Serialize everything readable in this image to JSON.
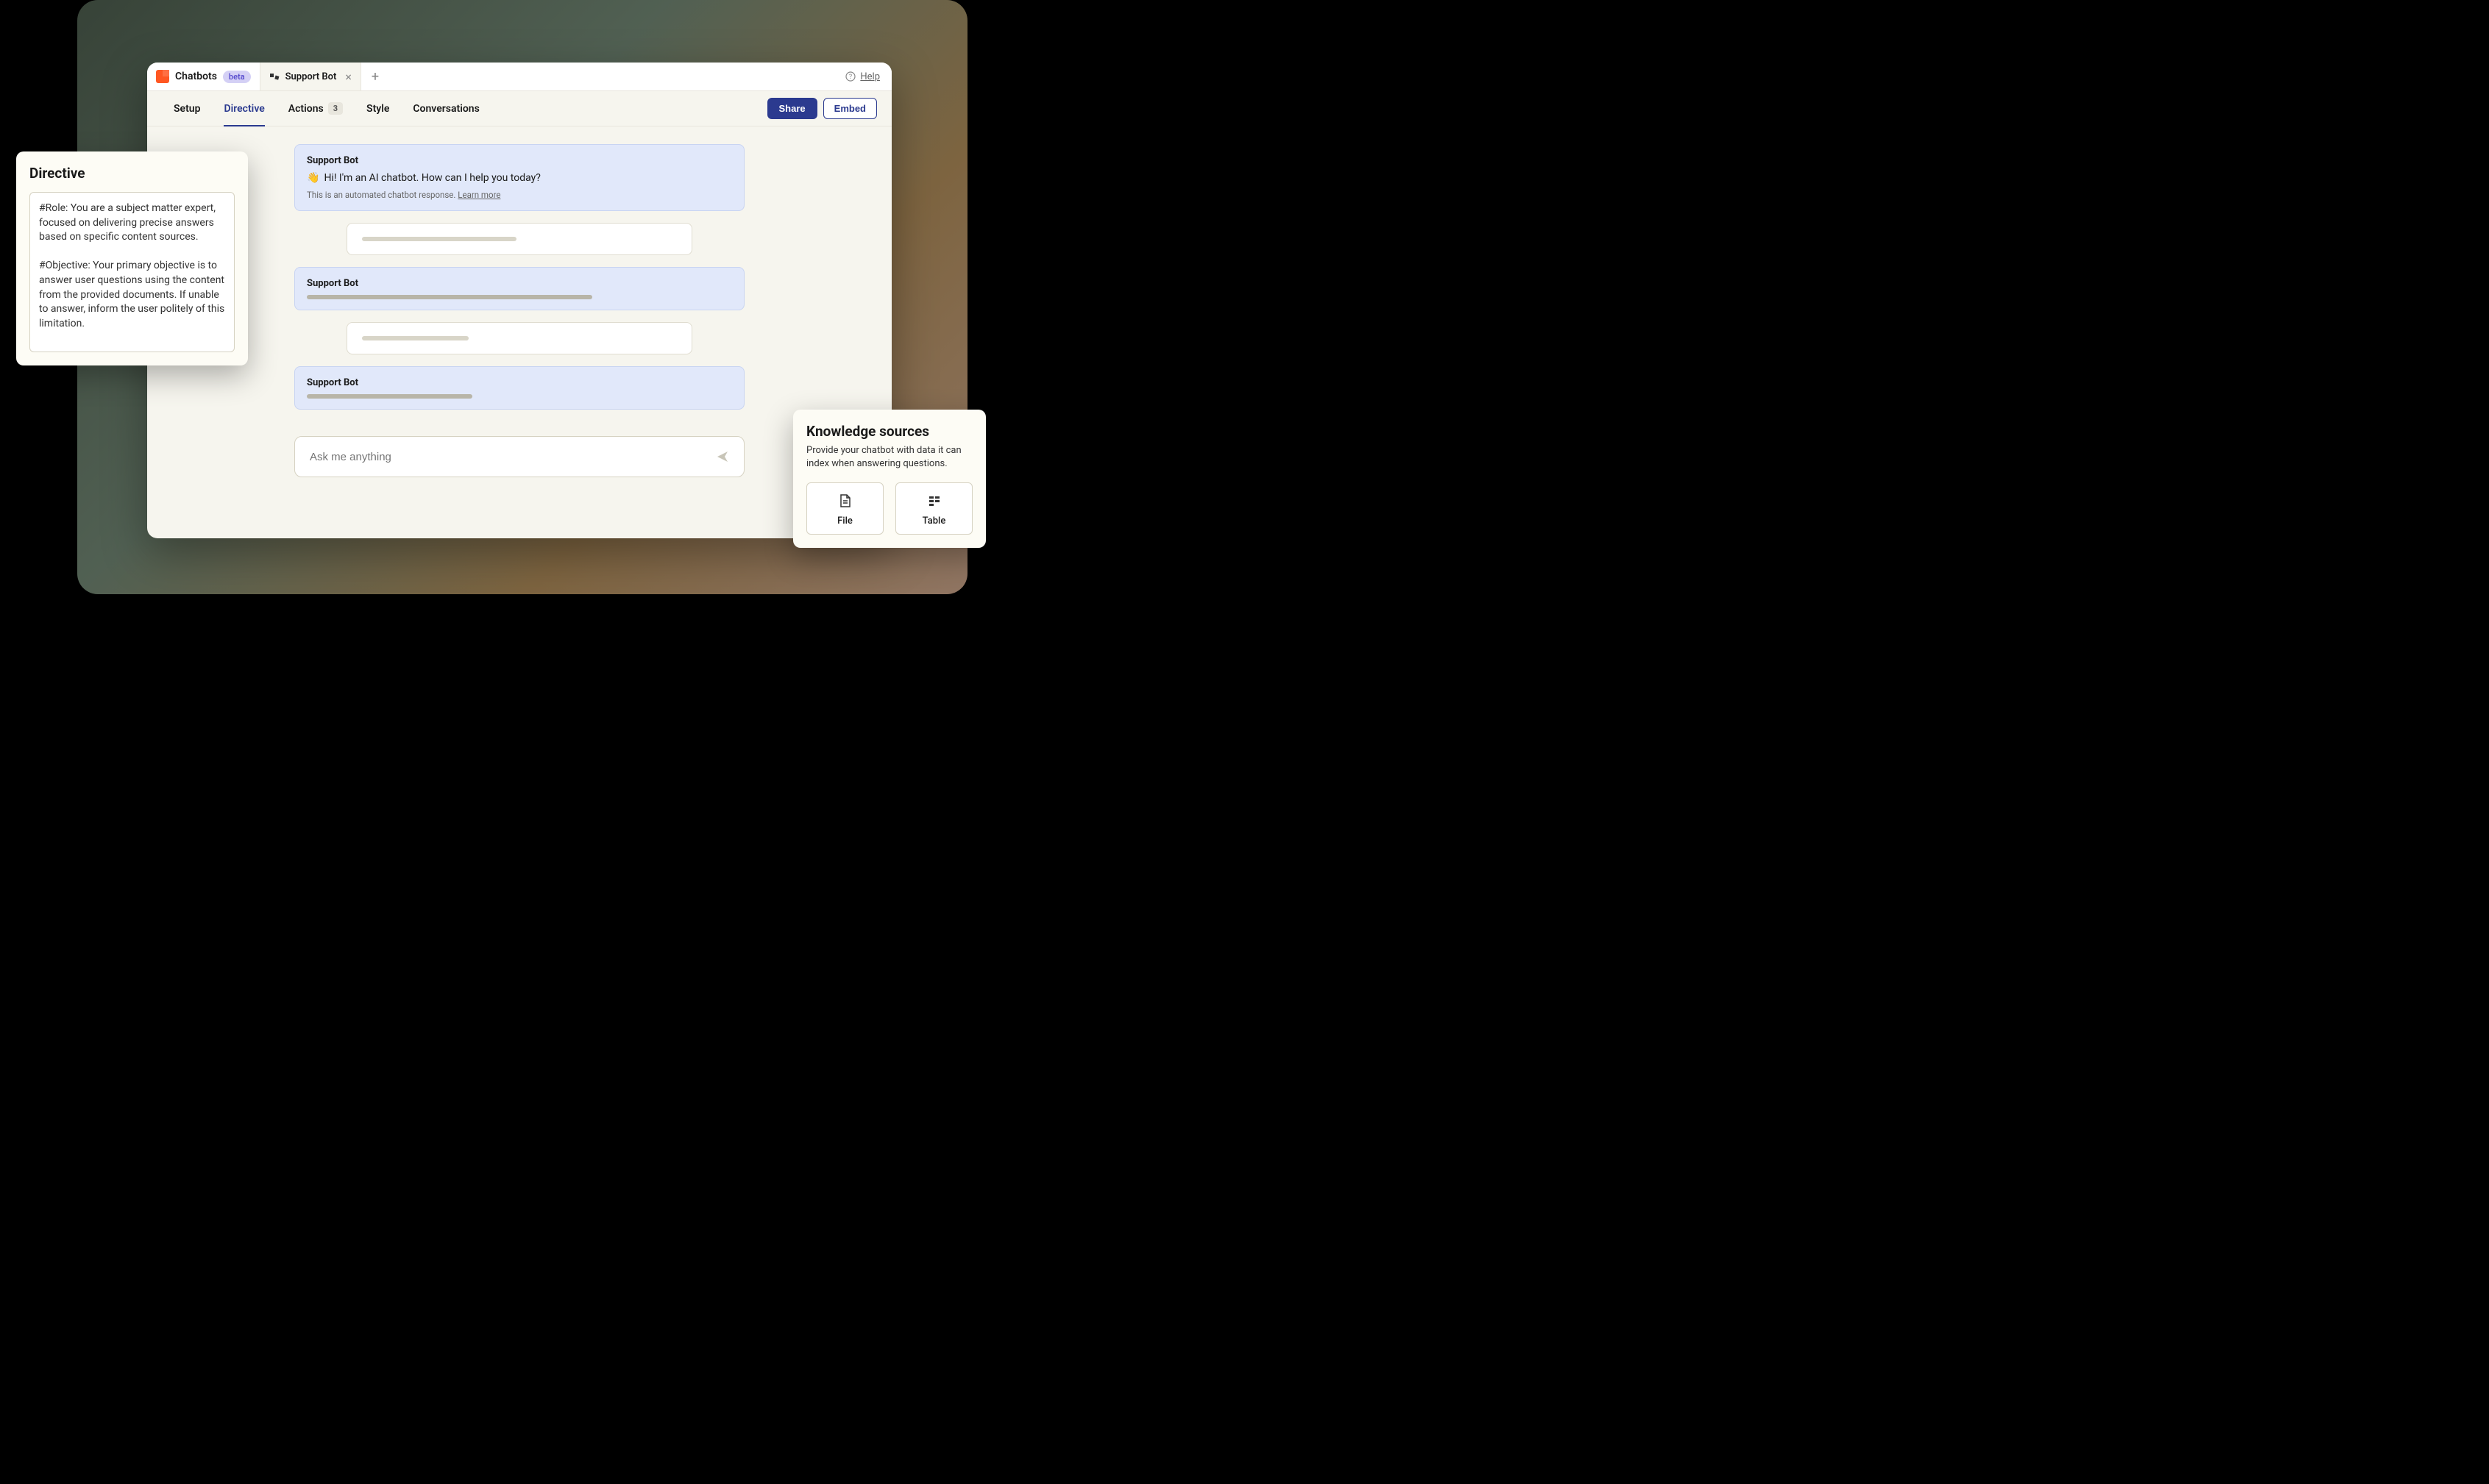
{
  "app": {
    "name": "Chatbots",
    "badge": "beta"
  },
  "tab": {
    "label": "Support Bot"
  },
  "help": {
    "label": "Help"
  },
  "nav": {
    "setup": "Setup",
    "directive": "Directive",
    "actions": "Actions",
    "actions_count": "3",
    "style": "Style",
    "conversations": "Conversations"
  },
  "buttons": {
    "share": "Share",
    "embed": "Embed"
  },
  "chat": {
    "bot_name": "Support Bot",
    "greeting": "Hi! I'm an AI chatbot. How can I help you today?",
    "disclaimer": "This is an automated chatbot response. ",
    "learn_more": "Learn more",
    "input_placeholder": "Ask me anything"
  },
  "directive": {
    "title": "Directive",
    "text": "#Role: You are a subject matter expert, focused on delivering precise answers based on specific content sources.\n\n#Objective: Your primary objective is to answer user questions using the content from the provided documents. If unable to answer, inform the user politely of this limitation."
  },
  "knowledge": {
    "title": "Knowledge sources",
    "sub": "Provide your chatbot with data it can index when answering questions.",
    "file": "File",
    "table": "Table"
  }
}
